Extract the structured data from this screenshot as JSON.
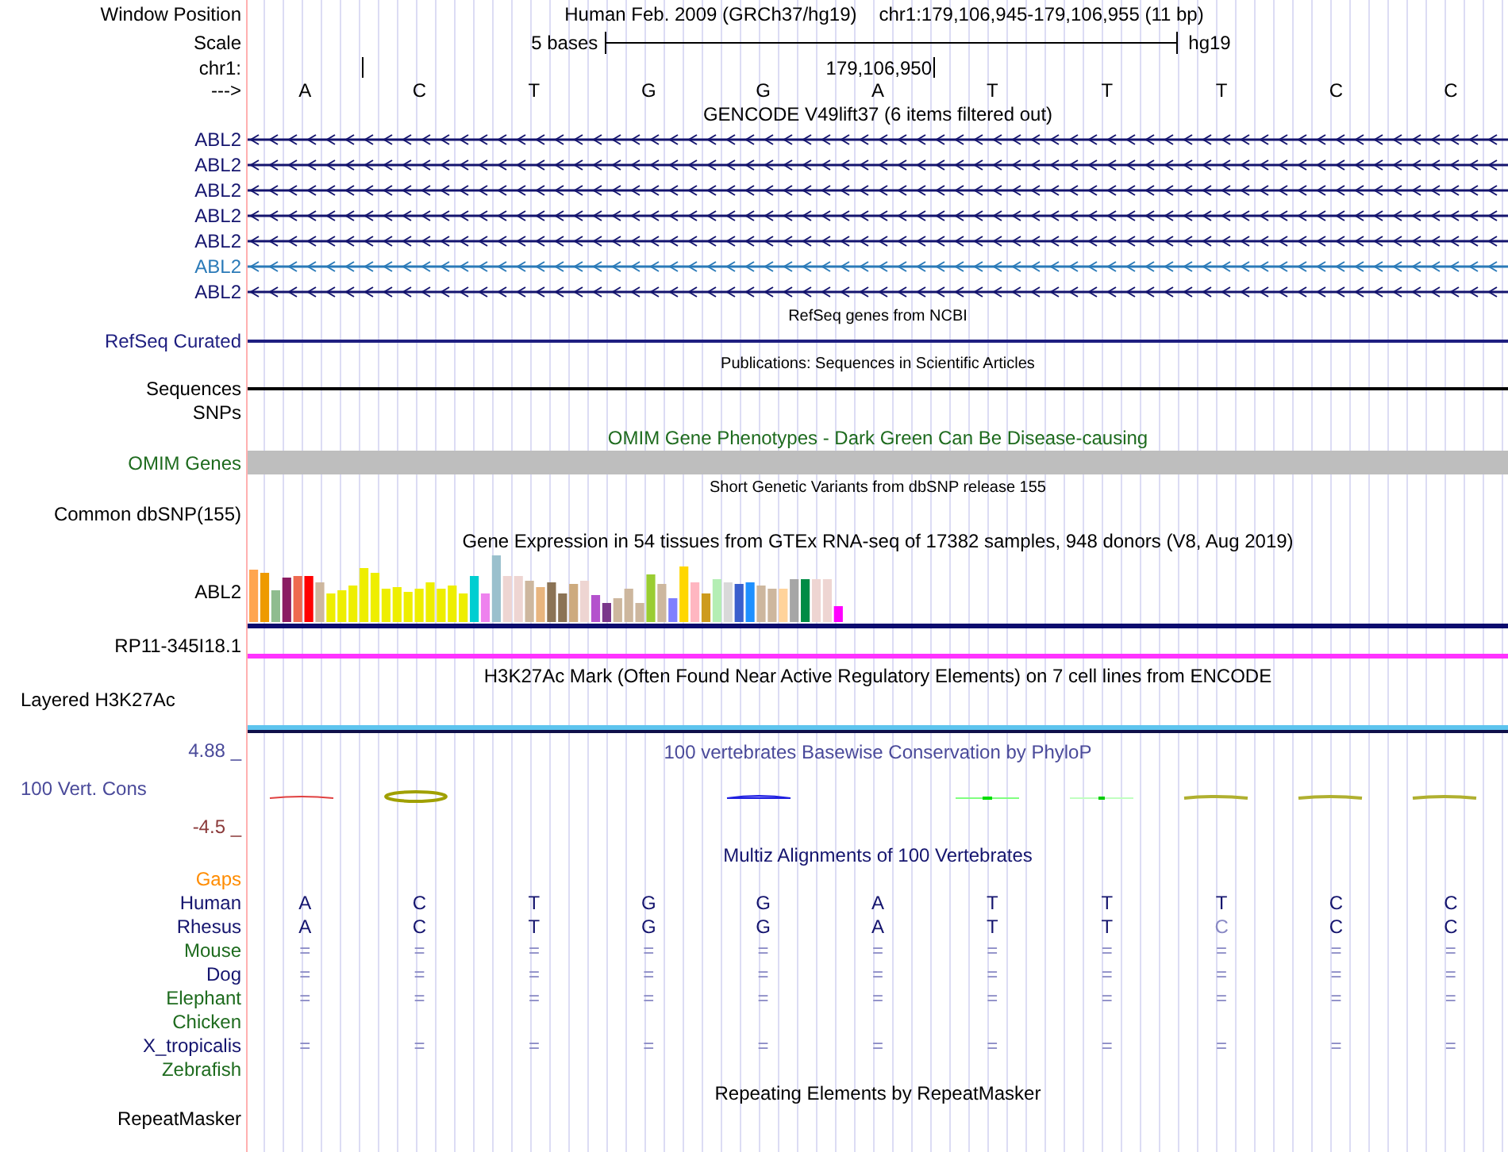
{
  "header": {
    "window_position_label": "Window Position",
    "assembly": "Human Feb. 2009 (GRCh37/hg19)",
    "position": "chr1:179,106,945-179,106,955 (11 bp)",
    "scale_label": "Scale",
    "scale_text": "5 bases",
    "scale_assembly": "hg19",
    "chrom_label": "chr1:",
    "chrom_coord": "179,106,950",
    "strand_label": "--->"
  },
  "bases": [
    "A",
    "C",
    "T",
    "G",
    "G",
    "A",
    "T",
    "T",
    "T",
    "C",
    "C"
  ],
  "tracks": [
    {
      "kind": "genes",
      "title": "GENCODE V49lift37 (6 items filtered out)",
      "items": [
        {
          "label": "ABL2",
          "color": "#14146e"
        },
        {
          "label": "ABL2",
          "color": "#14146e"
        },
        {
          "label": "ABL2",
          "color": "#14146e"
        },
        {
          "label": "ABL2",
          "color": "#14146e"
        },
        {
          "label": "ABL2",
          "color": "#14146e"
        },
        {
          "label": "ABL2",
          "color": "#2a7ab8"
        },
        {
          "label": "ABL2",
          "color": "#14146e"
        }
      ]
    },
    {
      "kind": "line",
      "title": "RefSeq genes from NCBI",
      "label": "RefSeq Curated",
      "color": "#1e1e80"
    },
    {
      "kind": "line",
      "title": "Publications: Sequences in Scientific Articles",
      "label": "Sequences",
      "color": "#000000"
    },
    {
      "kind": "empty",
      "label": "SNPs",
      "color": "#000000"
    },
    {
      "kind": "bar",
      "title": "OMIM Gene Phenotypes - Dark Green Can Be Disease-causing",
      "label": "OMIM Genes",
      "color": "#1e6b1e"
    },
    {
      "kind": "variants",
      "title": "Short Genetic Variants from dbSNP release 155",
      "label": "Common dbSNP(155)",
      "color": "#000000"
    },
    {
      "kind": "expression",
      "title": "Gene Expression in 54 tissues from GTEx RNA-seq of 17382 samples, 948 donors (V8, Aug 2019)",
      "label": "ABL2",
      "color": "#000000"
    },
    {
      "kind": "transcript",
      "label": "RP11-345I18.1",
      "color": "#ff33ff"
    },
    {
      "kind": "signal",
      "title": "H3K27Ac Mark (Often Found Near Active Regulatory Elements) on 7 cell lines from ENCODE",
      "label": "Layered H3K27Ac",
      "color": "#000000"
    },
    {
      "kind": "conservation",
      "title": "100 vertebrates Basewise Conservation by PhyloP",
      "label": "100 Vert. Cons",
      "max": "4.88 _",
      "min": "-4.5 _",
      "color": "#4a4a9a"
    },
    {
      "kind": "alignment",
      "title": "Multiz Alignments of 100 Vertebrates",
      "gaps_label": "Gaps",
      "species": [
        {
          "name": "Human",
          "color": "#14146e",
          "cells": [
            {
              "t": "A",
              "faded": false
            },
            {
              "t": "C",
              "faded": false
            },
            {
              "t": "T",
              "faded": false
            },
            {
              "t": "G",
              "faded": false
            },
            {
              "t": "G",
              "faded": false
            },
            {
              "t": "A",
              "faded": false
            },
            {
              "t": "T",
              "faded": false
            },
            {
              "t": "T",
              "faded": false
            },
            {
              "t": "T",
              "faded": false
            },
            {
              "t": "C",
              "faded": false
            },
            {
              "t": "C",
              "faded": false
            }
          ]
        },
        {
          "name": "Rhesus",
          "color": "#14146e",
          "cells": [
            {
              "t": "A",
              "faded": false
            },
            {
              "t": "C",
              "faded": false
            },
            {
              "t": "T",
              "faded": false
            },
            {
              "t": "G",
              "faded": false
            },
            {
              "t": "G",
              "faded": false
            },
            {
              "t": "A",
              "faded": false
            },
            {
              "t": "T",
              "faded": false
            },
            {
              "t": "T",
              "faded": false
            },
            {
              "t": "C",
              "faded": true
            },
            {
              "t": "C",
              "faded": false
            },
            {
              "t": "C",
              "faded": false
            }
          ]
        },
        {
          "name": "Mouse",
          "color": "#1e6b1e",
          "cells": [
            {
              "t": "=",
              "faded": true
            },
            {
              "t": "=",
              "faded": true
            },
            {
              "t": "=",
              "faded": true
            },
            {
              "t": "=",
              "faded": true
            },
            {
              "t": "=",
              "faded": true
            },
            {
              "t": "=",
              "faded": true
            },
            {
              "t": "=",
              "faded": true
            },
            {
              "t": "=",
              "faded": true
            },
            {
              "t": "=",
              "faded": true
            },
            {
              "t": "=",
              "faded": true
            },
            {
              "t": "=",
              "faded": true
            }
          ]
        },
        {
          "name": "Dog",
          "color": "#14146e",
          "cells": [
            {
              "t": "=",
              "faded": true
            },
            {
              "t": "=",
              "faded": true
            },
            {
              "t": "=",
              "faded": true
            },
            {
              "t": "=",
              "faded": true
            },
            {
              "t": "=",
              "faded": true
            },
            {
              "t": "=",
              "faded": true
            },
            {
              "t": "=",
              "faded": true
            },
            {
              "t": "=",
              "faded": true
            },
            {
              "t": "=",
              "faded": true
            },
            {
              "t": "=",
              "faded": true
            },
            {
              "t": "=",
              "faded": true
            }
          ]
        },
        {
          "name": "Elephant",
          "color": "#1e6b1e",
          "cells": [
            {
              "t": "=",
              "faded": true
            },
            {
              "t": "=",
              "faded": true
            },
            {
              "t": "=",
              "faded": true
            },
            {
              "t": "=",
              "faded": true
            },
            {
              "t": "=",
              "faded": true
            },
            {
              "t": "=",
              "faded": true
            },
            {
              "t": "=",
              "faded": true
            },
            {
              "t": "=",
              "faded": true
            },
            {
              "t": "=",
              "faded": true
            },
            {
              "t": "=",
              "faded": true
            },
            {
              "t": "=",
              "faded": true
            }
          ]
        },
        {
          "name": "Chicken",
          "color": "#1e6b1e"
        },
        {
          "name": "X_tropicalis",
          "color": "#14146e",
          "cells": [
            {
              "t": "=",
              "faded": true
            },
            {
              "t": "=",
              "faded": true
            },
            {
              "t": "=",
              "faded": true
            },
            {
              "t": "=",
              "faded": true
            },
            {
              "t": "=",
              "faded": true
            },
            {
              "t": "=",
              "faded": true
            },
            {
              "t": "=",
              "faded": true
            },
            {
              "t": "=",
              "faded": true
            },
            {
              "t": "=",
              "faded": true
            },
            {
              "t": "=",
              "faded": true
            },
            {
              "t": "=",
              "faded": true
            }
          ]
        },
        {
          "name": "Zebrafish",
          "color": "#1e6b1e"
        }
      ]
    },
    {
      "kind": "empty",
      "title": "Repeating Elements by RepeatMasker",
      "label": "RepeatMasker",
      "color": "#000000"
    }
  ]
}
